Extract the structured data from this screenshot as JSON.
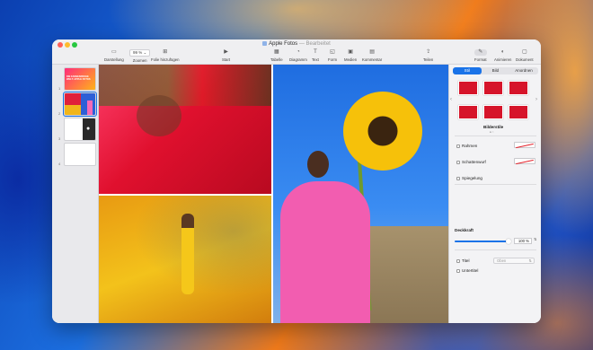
{
  "window": {
    "title": "Apple Fotos",
    "edited_suffix": "— Bearbeitet"
  },
  "toolbar": {
    "left": [
      {
        "label": "Darstellung",
        "icon": "sidebar-icon"
      },
      {
        "label": "Zoomen",
        "value": "99 %",
        "icon": "zoom-select"
      },
      {
        "label": "Folie hinzufügen",
        "icon": "plus-icon"
      }
    ],
    "center": [
      {
        "label": "Start",
        "icon": "play-icon"
      },
      {
        "label": "Tabelle",
        "icon": "table-icon"
      },
      {
        "label": "Diagramm",
        "icon": "chart-icon"
      },
      {
        "label": "Text",
        "icon": "text-icon"
      },
      {
        "label": "Form",
        "icon": "shape-icon"
      },
      {
        "label": "Medien",
        "icon": "media-icon"
      },
      {
        "label": "Kommentar",
        "icon": "comment-icon"
      }
    ],
    "right": [
      {
        "label": "Teilen",
        "icon": "share-icon"
      },
      {
        "label": "Format",
        "icon": "paintbrush-icon"
      },
      {
        "label": "Animieren",
        "icon": "animate-icon"
      },
      {
        "label": "Dokument",
        "icon": "document-icon"
      }
    ]
  },
  "sidebar": {
    "slides": [
      {
        "num": "1",
        "text": "DIE FARBENFROHE WELT: APPLE FOTOS"
      },
      {
        "num": "2",
        "text": ""
      },
      {
        "num": "3",
        "text": ""
      },
      {
        "num": "4",
        "text": ""
      }
    ]
  },
  "inspector": {
    "tabs": [
      "Stil",
      "Bild",
      "Anordnen"
    ],
    "section_styles": "Bilderstile",
    "rows": {
      "frame": "Rahmen",
      "shadow": "Schattenwurf",
      "reflection": "Spiegelung",
      "opacity": "Deckkraft",
      "title": "Titel",
      "title_placeholder": "Oben",
      "subtitle": "Untertitel"
    },
    "opacity_value": "100 %",
    "opacity_fraction": 1.0,
    "accent_color": "#1a73e8"
  }
}
